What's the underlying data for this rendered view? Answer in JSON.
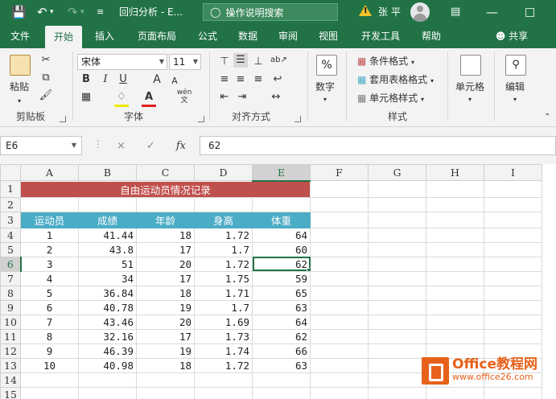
{
  "titlebar": {
    "save_icon": "save-icon",
    "undo_icon": "undo-icon",
    "redo_icon": "redo-icon",
    "customize_icon": "chevron-down-icon",
    "title": "回归分析 - E...",
    "search_placeholder": "操作说明搜索",
    "warning_icon": "warning-icon",
    "user_name": "张平",
    "minimize_icon": "minimize-icon",
    "maximize_icon": "maximize-icon"
  },
  "tabs": [
    "文件",
    "开始",
    "插入",
    "页面布局",
    "公式",
    "数据",
    "审阅",
    "视图",
    "开发工具",
    "帮助"
  ],
  "share_label": "共享",
  "ribbon": {
    "clipboard": {
      "paste_label": "粘贴",
      "group_label": "剪贴板"
    },
    "font": {
      "font_name": "宋体",
      "font_size": "11",
      "bold": "B",
      "italic": "I",
      "underline": "U",
      "increase": "A",
      "decrease": "A",
      "pinyin": "wén",
      "group_label": "字体"
    },
    "alignment": {
      "group_label": "对齐方式"
    },
    "number": {
      "percent": "%",
      "label": "数字"
    },
    "styles": {
      "conditional": "条件格式",
      "table_format": "套用表格格式",
      "cell_styles": "单元格样式",
      "group_label": "样式"
    },
    "cells": {
      "label": "单元格"
    },
    "editing": {
      "label": "编辑"
    }
  },
  "formula_bar": {
    "name_box": "E6",
    "cancel_icon": "×",
    "enter_icon": "✓",
    "fx": "fx",
    "value": "62"
  },
  "sheet": {
    "columns": [
      "A",
      "B",
      "C",
      "D",
      "E",
      "F",
      "G",
      "H",
      "I"
    ],
    "rows": [
      "1",
      "2",
      "3",
      "4",
      "5",
      "6",
      "7",
      "8",
      "9",
      "10",
      "11",
      "12",
      "13",
      "14",
      "15"
    ],
    "title": "自由运动员情况记录",
    "headers": [
      "运动员",
      "成绩",
      "年龄",
      "身高",
      "体重"
    ],
    "data": [
      [
        "1",
        "41.44",
        "18",
        "1.72",
        "64"
      ],
      [
        "2",
        "43.8",
        "17",
        "1.7",
        "60"
      ],
      [
        "3",
        "51",
        "20",
        "1.72",
        "62"
      ],
      [
        "4",
        "34",
        "17",
        "1.75",
        "59"
      ],
      [
        "5",
        "36.84",
        "18",
        "1.71",
        "65"
      ],
      [
        "6",
        "40.78",
        "19",
        "1.7",
        "63"
      ],
      [
        "7",
        "43.46",
        "20",
        "1.69",
        "64"
      ],
      [
        "8",
        "32.16",
        "17",
        "1.73",
        "62"
      ],
      [
        "9",
        "46.39",
        "19",
        "1.74",
        "66"
      ],
      [
        "10",
        "40.98",
        "18",
        "1.72",
        "63"
      ]
    ],
    "active_cell": "E6",
    "title_color": "#c0504d",
    "header_color": "#4bacc6"
  },
  "watermark": {
    "brand": "Office教程网",
    "url": "www.office26.com"
  },
  "colors": {
    "excel_green": "#217346"
  }
}
